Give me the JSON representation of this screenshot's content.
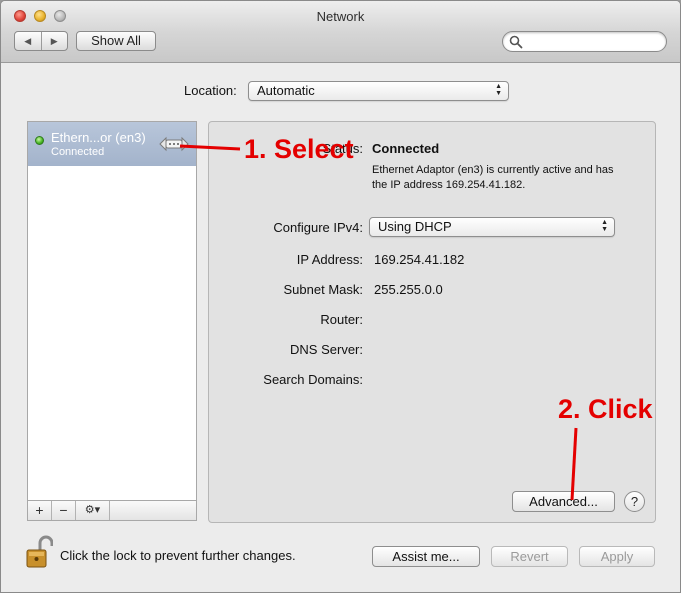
{
  "window": {
    "title": "Network"
  },
  "toolbar": {
    "back_glyph": "◀",
    "forward_glyph": "▶",
    "show_all_label": "Show All",
    "search_placeholder": ""
  },
  "location": {
    "label": "Location:",
    "value": "Automatic"
  },
  "sidebar": {
    "items": [
      {
        "name": "Ethern...or (en3)",
        "status": "Connected",
        "icon": "ethernet-icon",
        "status_color": "#46b522"
      }
    ],
    "add_label": "+",
    "remove_label": "−",
    "gear_label": "⚙▾"
  },
  "detail": {
    "status_label": "Status:",
    "status_value": "Connected",
    "status_description": "Ethernet Adaptor (en3) is currently active and has the IP address 169.254.41.182.",
    "fields": [
      {
        "label": "Configure IPv4:",
        "value": "Using DHCP"
      },
      {
        "label": "IP Address:",
        "value": "169.254.41.182"
      },
      {
        "label": "Subnet Mask:",
        "value": "255.255.0.0"
      },
      {
        "label": "Router:",
        "value": ""
      },
      {
        "label": "DNS Server:",
        "value": ""
      },
      {
        "label": "Search Domains:",
        "value": ""
      }
    ],
    "advanced_label": "Advanced...",
    "help_label": "?"
  },
  "footer": {
    "lock_text": "Click the lock to prevent further changes.",
    "assist_label": "Assist me...",
    "revert_label": "Revert",
    "apply_label": "Apply"
  },
  "annotations": {
    "select_text": "1. Select",
    "click_text": "2. Click",
    "color": "#e40000"
  }
}
